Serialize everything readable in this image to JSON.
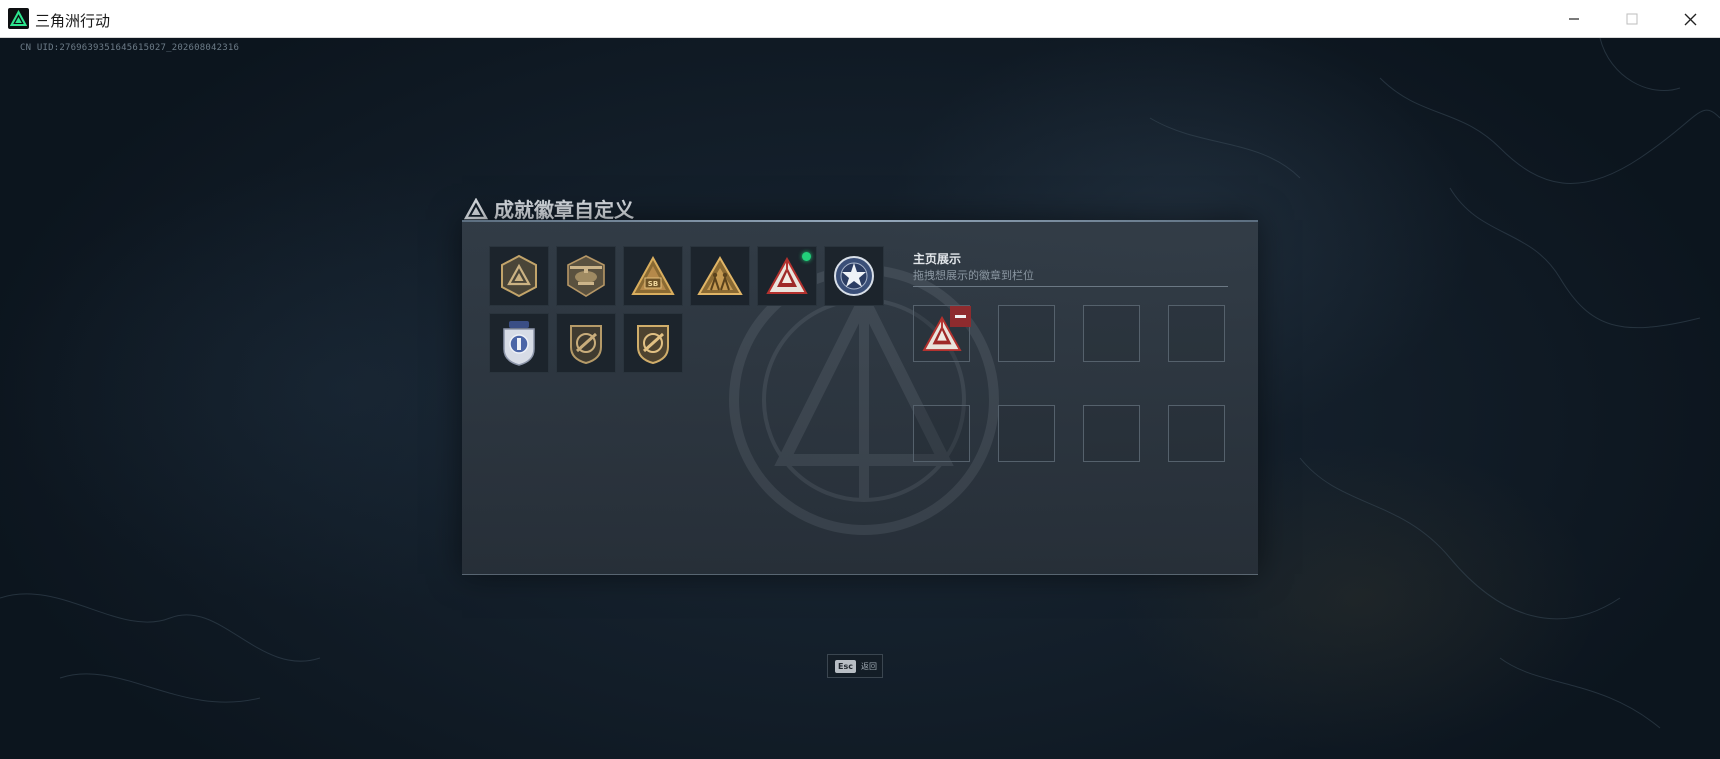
{
  "window": {
    "title": "三角洲行动",
    "controls": [
      "minimize-icon",
      "maximize-icon",
      "close-icon"
    ]
  },
  "game": {
    "uid_text": "CN UID:2769639351645615027_202608042316"
  },
  "dialog": {
    "title": "成就徽章自定义",
    "badges": [
      {
        "icon": "hexagon-triangle-badge-icon",
        "selected": false
      },
      {
        "icon": "helicopter-badge-icon",
        "selected": false
      },
      {
        "icon": "gold-triangle-sb-badge-icon",
        "selected": false
      },
      {
        "icon": "gold-soldiers-triangle-badge-icon",
        "selected": false
      },
      {
        "icon": "red-white-triangle-badge-icon",
        "selected": true
      },
      {
        "icon": "star-wings-badge-icon",
        "selected": false
      },
      {
        "icon": "police-shield-badge-icon",
        "selected": false
      },
      {
        "icon": "rifle-shield-badge-icon",
        "selected": false
      },
      {
        "icon": "rifle-shield-gold-badge-icon",
        "selected": false
      }
    ],
    "showcase": {
      "title": "主页展示",
      "subtitle": "拖拽想展示的徽章到栏位",
      "slots": [
        {
          "filled": true,
          "icon": "red-white-triangle-badge-icon"
        },
        {
          "filled": false
        },
        {
          "filled": false
        },
        {
          "filled": false
        },
        {
          "filled": false
        },
        {
          "filled": false
        },
        {
          "filled": false
        },
        {
          "filled": false
        }
      ]
    }
  },
  "footer": {
    "esc_key": "Esc",
    "esc_label": "返回"
  },
  "colors": {
    "accent_green": "#22d07a",
    "remove_red": "#8e2b2e",
    "gold": "#c79a4a"
  }
}
